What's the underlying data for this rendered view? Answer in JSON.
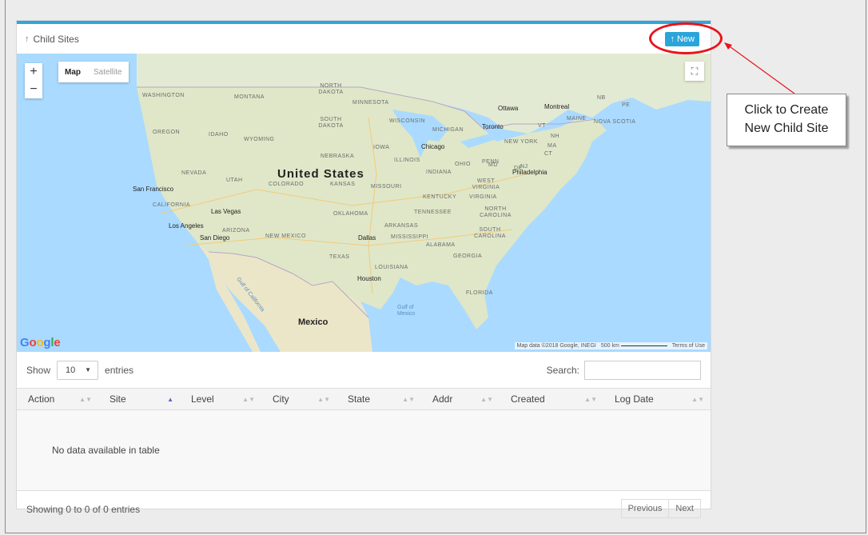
{
  "panel": {
    "title": "Child Sites",
    "new_button": "New"
  },
  "map": {
    "zoom_in": "+",
    "zoom_out": "−",
    "type_map": "Map",
    "type_satellite": "Satellite",
    "google": [
      "G",
      "o",
      "o",
      "g",
      "l",
      "e"
    ],
    "attribution": "Map data ©2018 Google, INEGI",
    "scale": "500 km",
    "terms": "Terms of Use",
    "country_label": "United States",
    "mexico_label": "Mexico",
    "states": [
      "WASHINGTON",
      "MONTANA",
      "NORTH DAKOTA",
      "MINNESOTA",
      "SOUTH DAKOTA",
      "WISCONSIN",
      "OREGON",
      "IDAHO",
      "WYOMING",
      "MICHIGAN",
      "NEBRASKA",
      "IOWA",
      "NEVADA",
      "UTAH",
      "COLORADO",
      "KANSAS",
      "ILLINOIS",
      "INDIANA",
      "OHIO",
      "PENN",
      "MISSOURI",
      "WEST VIRGINIA",
      "KENTUCKY",
      "VIRGINIA",
      "CALIFORNIA",
      "OKLAHOMA",
      "TENNESSEE",
      "NORTH CAROLINA",
      "ARIZONA",
      "NEW MEXICO",
      "ARKANSAS",
      "SOUTH CAROLINA",
      "MISSISSIPPI",
      "ALABAMA",
      "GEORGIA",
      "TEXAS",
      "LOUISIANA",
      "FLORIDA",
      "NEW YORK",
      "VT",
      "NH",
      "MA",
      "CT",
      "NJ",
      "DE",
      "MD",
      "MAINE",
      "NB",
      "PE",
      "NOVA SCOTIA"
    ],
    "cities": [
      "San Francisco",
      "Las Vegas",
      "Los Angeles",
      "San Diego",
      "Dallas",
      "Houston",
      "Chicago",
      "Toronto",
      "Ottawa",
      "Montreal",
      "Philadelphia"
    ],
    "water": [
      "Gulf of Mexico",
      "Gulf of California"
    ]
  },
  "table_controls": {
    "show_label": "Show",
    "page_size": "10",
    "entries_label": "entries",
    "search_label": "Search:"
  },
  "table": {
    "columns": [
      "Action",
      "Site",
      "Level",
      "City",
      "State",
      "Addr",
      "Created",
      "Log Date"
    ],
    "empty_message": "No data available in table"
  },
  "footer": {
    "showing": "Showing 0 to 0 of 0 entries",
    "previous": "Previous",
    "next": "Next"
  },
  "callout": {
    "line1": "Click to Create",
    "line2": "New Child Site",
    "color": "#e8141c"
  }
}
